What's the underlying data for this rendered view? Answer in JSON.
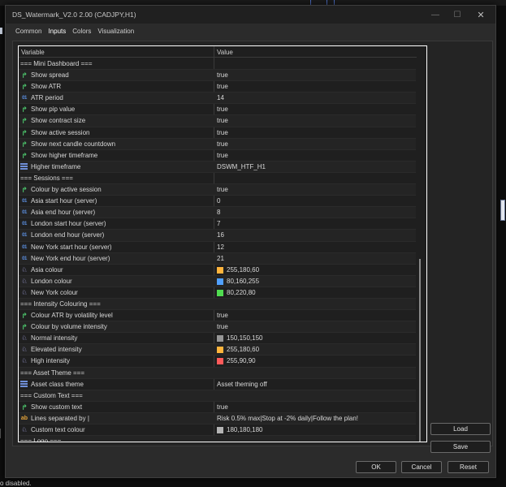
{
  "background": {
    "bottom_text": "o disabled."
  },
  "window": {
    "title": "DS_Watermark_V2.0 2.00 (CADJPY,H1)",
    "minimize_glyph": "—",
    "maximize_glyph": "☐",
    "close_glyph": "✕"
  },
  "tabs": [
    {
      "label": "Common"
    },
    {
      "label": "Inputs"
    },
    {
      "label": "Colors"
    },
    {
      "label": "Visualization"
    }
  ],
  "active_tab": "Inputs",
  "grid": {
    "headers": {
      "variable": "Variable",
      "value": "Value"
    },
    "rows": [
      {
        "variable": "=== Mini Dashboard ===",
        "value": "",
        "icon": "none",
        "type": "header"
      },
      {
        "variable": "Show spread",
        "value": "true",
        "icon": "bool-icon"
      },
      {
        "variable": "Show ATR",
        "value": "true",
        "icon": "bool-icon"
      },
      {
        "variable": "ATR period",
        "value": "14",
        "icon": "number-icon"
      },
      {
        "variable": "Show pip value",
        "value": "true",
        "icon": "bool-icon"
      },
      {
        "variable": "Show contract size",
        "value": "true",
        "icon": "bool-icon"
      },
      {
        "variable": "Show active session",
        "value": "true",
        "icon": "bool-icon"
      },
      {
        "variable": "Show next candle countdown",
        "value": "true",
        "icon": "bool-icon"
      },
      {
        "variable": "Show higher timeframe",
        "value": "true",
        "icon": "bool-icon"
      },
      {
        "variable": "Higher timeframe",
        "value": "DSWM_HTF_H1",
        "icon": "enum-icon"
      },
      {
        "variable": "=== Sessions ===",
        "value": "",
        "icon": "none",
        "type": "header"
      },
      {
        "variable": "Colour by active session",
        "value": "true",
        "icon": "bool-icon"
      },
      {
        "variable": "Asia start hour (server)",
        "value": "0",
        "icon": "number-icon"
      },
      {
        "variable": "Asia end hour (server)",
        "value": "8",
        "icon": "number-icon"
      },
      {
        "variable": "London start hour (server)",
        "value": "7",
        "icon": "number-icon"
      },
      {
        "variable": "London end hour (server)",
        "value": "16",
        "icon": "number-icon"
      },
      {
        "variable": "New York start hour (server)",
        "value": "12",
        "icon": "number-icon"
      },
      {
        "variable": "New York end hour (server)",
        "value": "21",
        "icon": "number-icon"
      },
      {
        "variable": "Asia colour",
        "value": "255,180,60",
        "icon": "color-icon",
        "swatch": "#ffb43c"
      },
      {
        "variable": "London colour",
        "value": "80,160,255",
        "icon": "color-icon",
        "swatch": "#50a0ff"
      },
      {
        "variable": "New York colour",
        "value": "80,220,80",
        "icon": "color-icon",
        "swatch": "#50dc50"
      },
      {
        "variable": "=== Intensity Colouring ===",
        "value": "",
        "icon": "none",
        "type": "header"
      },
      {
        "variable": "Colour ATR by volatility level",
        "value": "true",
        "icon": "bool-icon"
      },
      {
        "variable": "Colour by volume intensity",
        "value": "true",
        "icon": "bool-icon"
      },
      {
        "variable": "Normal intensity",
        "value": "150,150,150",
        "icon": "color-icon",
        "swatch": "#969696"
      },
      {
        "variable": "Elevated intensity",
        "value": "255,180,60",
        "icon": "color-icon",
        "swatch": "#ffb43c"
      },
      {
        "variable": "High intensity",
        "value": "255,90,90",
        "icon": "color-icon",
        "swatch": "#ff5a5a"
      },
      {
        "variable": "=== Asset Theme ===",
        "value": "",
        "icon": "none",
        "type": "header"
      },
      {
        "variable": "Asset class theme",
        "value": "Asset theming off",
        "icon": "enum-icon"
      },
      {
        "variable": "=== Custom Text ===",
        "value": "",
        "icon": "none",
        "type": "header"
      },
      {
        "variable": "Show custom text",
        "value": "true",
        "icon": "bool-icon"
      },
      {
        "variable": "Lines separated by |",
        "value": "Risk 0.5% max|Stop at -2% daily|Follow the plan!",
        "icon": "string-icon"
      },
      {
        "variable": "Custom text colour",
        "value": "180,180,180",
        "icon": "color-icon",
        "swatch": "#b4b4b4"
      },
      {
        "variable": "=== Logo ===",
        "value": "",
        "icon": "none",
        "type": "header"
      }
    ]
  },
  "buttons": {
    "load": "Load",
    "save": "Save",
    "ok": "OK",
    "cancel": "Cancel",
    "reset": "Reset"
  }
}
